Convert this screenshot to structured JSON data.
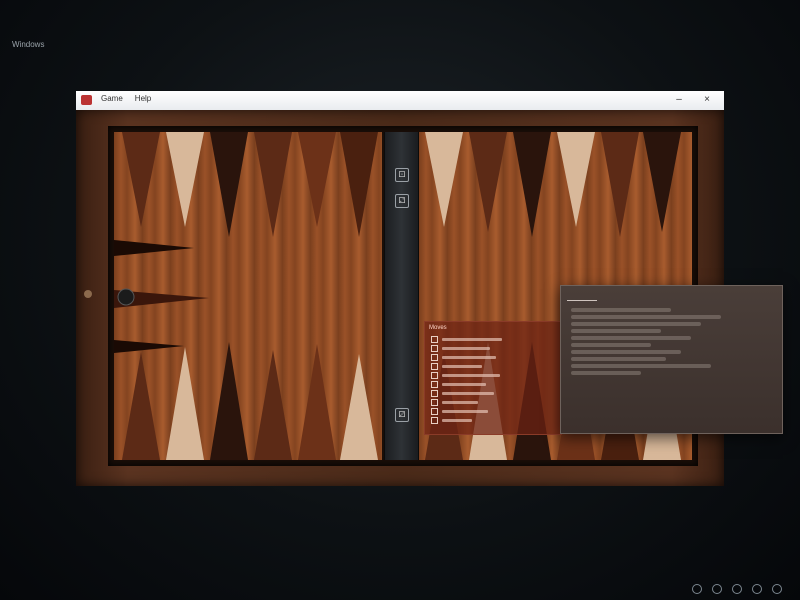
{
  "desktop": {
    "corner_label": "Windows"
  },
  "window": {
    "menu": [
      "Game",
      "Help"
    ],
    "controls": {
      "minimize": "–",
      "close": "×"
    }
  },
  "board": {
    "dice_top": "⚀",
    "dice_second": "⚁",
    "dice_bottom": "⚂"
  },
  "movelist": {
    "header": "Moves"
  },
  "dialog": {
    "tab1": "",
    "tab2": ""
  },
  "taskbar": {
    "clock_time": "",
    "clock_date": ""
  },
  "colors": {
    "point_dark": "#2a140c",
    "point_light": "#d8b89a",
    "point_red": "#b4532a",
    "bar": "#2e3236"
  }
}
